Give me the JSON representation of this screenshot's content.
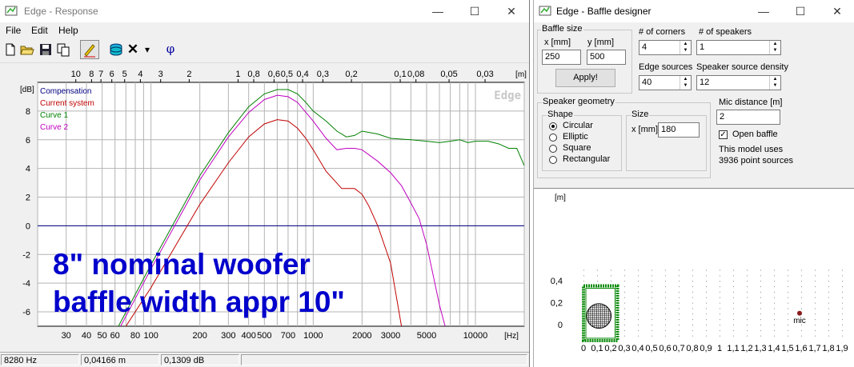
{
  "response_window": {
    "title": "Edge - Response",
    "controls": {
      "minimize": "—",
      "maximize": "☐",
      "close": "✕"
    },
    "menu": [
      "File",
      "Edit",
      "Help"
    ],
    "toolbar_icons": [
      "new-file-icon",
      "open-folder-icon",
      "save-icon",
      "copy-icon",
      "pen-icon",
      "stack-icon",
      "delete-x-icon",
      "dropdown-arrow-icon",
      "phi-icon"
    ],
    "phi_label": "φ",
    "delete_label": "✕",
    "dropdown_label": "▾",
    "status": [
      "8280 Hz",
      "0,04166 m",
      "0,1309 dB"
    ]
  },
  "chart_data": {
    "type": "line",
    "watermark": "Edge",
    "y_unit": "[dB]",
    "x_unit": "[Hz]",
    "top_unit": "[m]",
    "ylim": [
      -7,
      10
    ],
    "xlim": [
      20,
      20000
    ],
    "x_scale": "log",
    "y_ticks": [
      8,
      6,
      4,
      2,
      0,
      -2,
      -4,
      -6
    ],
    "x_ticks": [
      30,
      40,
      50,
      60,
      80,
      100,
      200,
      300,
      400,
      500,
      700,
      1000,
      2000,
      3000,
      5000,
      10000
    ],
    "x_tick_labels": [
      "30",
      "40",
      "50",
      "60",
      "80",
      "100",
      "200",
      "300",
      "400",
      "500",
      "700",
      "1000",
      "2000",
      "3000",
      "5000",
      "10000"
    ],
    "top_ticks": [
      "10",
      "8",
      "7",
      "6",
      "5",
      "4",
      "3",
      "2",
      "1",
      "0,8",
      "0,6",
      "0,5",
      "0,4",
      "0,3",
      "0,2",
      "0,1",
      "0,08",
      "0,05",
      "0,03"
    ],
    "grid": true,
    "legend_position": "top-left",
    "annotation_lines": [
      "8\" nominal woofer",
      "baffle width appr 10\""
    ],
    "series": [
      {
        "name": "Compensation",
        "color": "#000080",
        "x": [
          20,
          20000
        ],
        "y": [
          0,
          0
        ]
      },
      {
        "name": "Current system",
        "color": "#c00000",
        "x": [
          70,
          100,
          200,
          300,
          400,
          500,
          600,
          700,
          800,
          900,
          1000,
          1200,
          1500,
          1800,
          2000,
          2200,
          2500,
          3000,
          3500
        ],
        "y": [
          -7,
          -4.3,
          1.5,
          4.4,
          6.2,
          7.1,
          7.4,
          7.3,
          6.8,
          6.1,
          5.3,
          3.8,
          2.6,
          2.6,
          2.2,
          1.4,
          0,
          -2.6,
          -7
        ]
      },
      {
        "name": "Curve 1",
        "color": "#008000",
        "x": [
          63,
          100,
          200,
          300,
          400,
          500,
          600,
          700,
          800,
          900,
          1000,
          1200,
          1400,
          1600,
          1800,
          2000,
          2500,
          3000,
          4000,
          5000,
          6000,
          7000,
          8000,
          9000,
          10000,
          12000,
          14000,
          16000,
          18000,
          20000
        ],
        "y": [
          -7,
          -2.7,
          3.5,
          6.5,
          8.3,
          9.2,
          9.5,
          9.5,
          9.2,
          8.6,
          8.0,
          7.3,
          6.6,
          6.2,
          6.3,
          6.6,
          6.4,
          6.1,
          6.0,
          5.9,
          5.8,
          5.9,
          6.0,
          5.8,
          5.9,
          5.9,
          5.7,
          5.4,
          5.4,
          4.2
        ]
      },
      {
        "name": "Curve 2",
        "color": "#c000c0",
        "x": [
          65,
          100,
          200,
          300,
          400,
          500,
          600,
          700,
          800,
          1000,
          1200,
          1400,
          1600,
          1800,
          2000,
          2500,
          3000,
          3500,
          4000,
          4500,
          5000,
          5500,
          6000,
          6500
        ],
        "y": [
          -7,
          -3.0,
          3.2,
          6.2,
          7.9,
          8.8,
          9.1,
          9.0,
          8.6,
          7.3,
          6.1,
          5.3,
          5.4,
          5.4,
          5.3,
          4.5,
          3.7,
          2.8,
          1.6,
          0.5,
          -1.3,
          -3.5,
          -5.5,
          -7
        ]
      }
    ]
  },
  "baffle_window": {
    "title": "Edge - Baffle designer",
    "controls": {
      "minimize": "—",
      "maximize": "☐",
      "close": "✕"
    },
    "baffle_size": {
      "group_label": "Baffle size",
      "x_label": "x [mm]",
      "y_label": "y [mm]",
      "x_value": "250",
      "y_value": "500",
      "apply_label": "Apply!"
    },
    "corners": {
      "label": "# of corners",
      "value": "4"
    },
    "speakers": {
      "label": "# of speakers",
      "value": "1"
    },
    "edge_sources": {
      "label": "Edge sources",
      "value": "40"
    },
    "speaker_density": {
      "label": "Speaker source density",
      "value": "12"
    },
    "speaker_geometry": {
      "group_label": "Speaker geometry",
      "shape_label": "Shape",
      "shapes": [
        "Circular",
        "Elliptic",
        "Square",
        "Rectangular"
      ],
      "selected_shape": "Circular",
      "size_label": "Size",
      "size_unit": "x [mm]",
      "size_value": "180"
    },
    "mic_distance": {
      "label": "Mic distance [m]",
      "value": "2"
    },
    "open_baffle": {
      "label": "Open baffle",
      "checked": true,
      "check_glyph": "✓"
    },
    "info_lines": [
      "This model uses",
      "3936 point sources"
    ],
    "layout_plot": {
      "unit": "[m]",
      "y_ticks": [
        "0,4",
        "0,2",
        "0"
      ],
      "x_ticks": [
        "0",
        "0,1",
        "0,2",
        "0,3",
        "0,4",
        "0,5",
        "0,6",
        "0,7",
        "0,8",
        "0,9",
        "1",
        "1,1",
        "1,2",
        "1,3",
        "1,4",
        "1,5",
        "1,6",
        "1,7",
        "1,8",
        "1,9"
      ],
      "baffle_w_m": 0.25,
      "baffle_h_m": 0.5,
      "speaker_diameter_m": 0.18,
      "mic_label": "mic",
      "mic_x_m": 2.0,
      "mic_y_m": 0.25
    }
  }
}
